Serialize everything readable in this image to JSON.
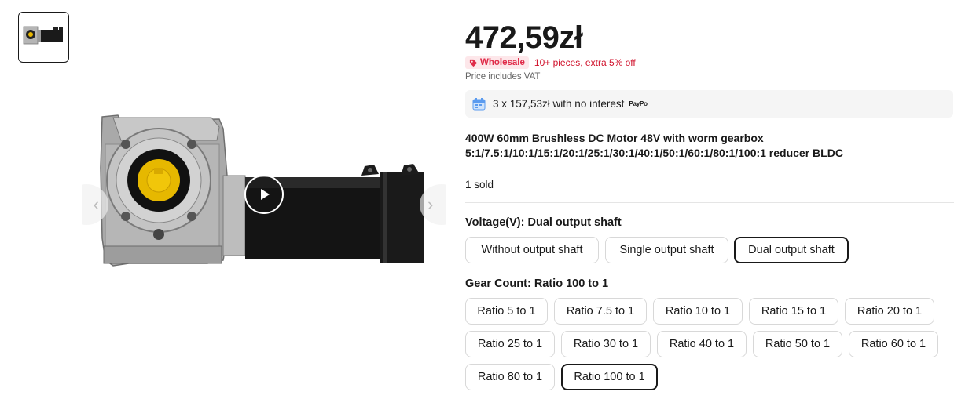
{
  "gallery": {
    "thumbnails": [
      {
        "icon": "motor-thumbnail"
      }
    ],
    "prev_icon": "‹",
    "next_icon": "›",
    "play_icon": "play-icon"
  },
  "product": {
    "price": "472,59zł",
    "wholesale_badge": "Wholesale",
    "promo_text": "10+ pieces, extra 5% off",
    "vat_note": "Price includes VAT",
    "installment_text": "3 x 157,53zł with no interest",
    "installment_provider": "PayPo",
    "title": "400W 60mm Brushless DC Motor 48V with worm gearbox 5:1/7.5:1/10:1/15:1/20:1/25:1/30:1/40:1/50:1/60:1/80:1/100:1 reducer BLDC",
    "sold": "1 sold"
  },
  "voltage": {
    "label": "Voltage(V): ",
    "selected_value": "Dual output shaft",
    "options": [
      "Without output shaft",
      "Single output shaft",
      "Dual output shaft"
    ],
    "selected_index": 2
  },
  "gear": {
    "label": "Gear Count: ",
    "selected_value": "Ratio 100 to 1",
    "options": [
      "Ratio 5 to 1",
      "Ratio 7.5 to 1",
      "Ratio 10 to 1",
      "Ratio 15 to 1",
      "Ratio 20 to 1",
      "Ratio 25 to 1",
      "Ratio 30 to 1",
      "Ratio 40 to 1",
      "Ratio 50 to 1",
      "Ratio 60 to 1",
      "Ratio 80 to 1",
      "Ratio 100 to 1"
    ],
    "selected_index": 11
  },
  "colors": {
    "accent_red": "#e02a48",
    "promo_red": "#d0112b",
    "badge_bg": "#fde7ea",
    "text": "#191919"
  }
}
